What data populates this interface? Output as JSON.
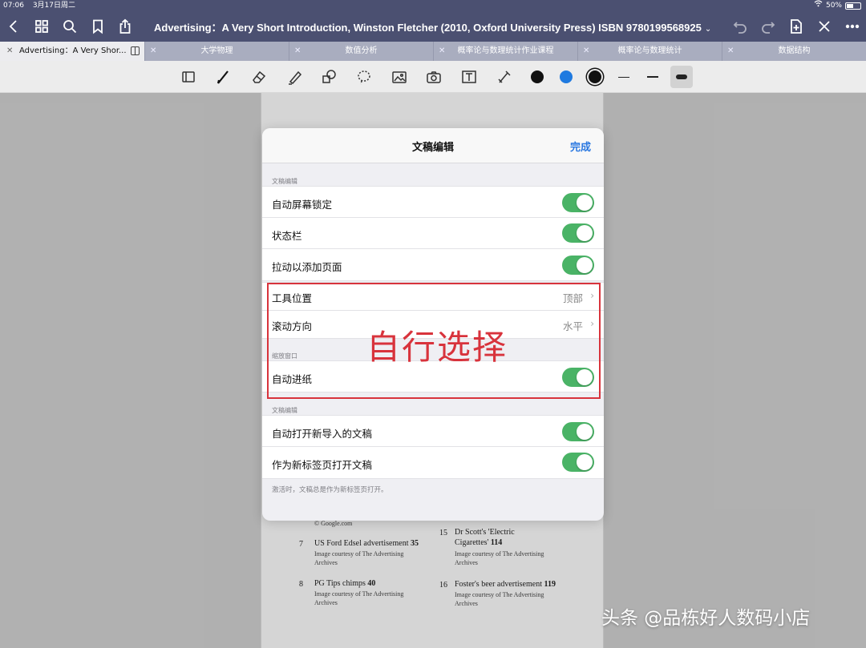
{
  "status_bar": {
    "time": "07:06",
    "date": "3月17日周二",
    "battery": "50%",
    "battery_level": 0.5
  },
  "nav": {
    "doc_title": "Advertising：A Very Short Introduction, Winston Fletcher (2010, Oxford University Press) ISBN 9780199568925",
    "title_chevron": "⌄"
  },
  "tabs": [
    {
      "label": "Advertising：A Very Shor...",
      "active": true
    },
    {
      "label": "大学物理",
      "active": false
    },
    {
      "label": "数值分析",
      "active": false
    },
    {
      "label": "概率论与数理统计作业课程",
      "active": false
    },
    {
      "label": "概率论与数理统计",
      "active": false
    },
    {
      "label": "数据结构",
      "active": false
    }
  ],
  "toolbar": {
    "colors": [
      "#111111",
      "#1f7ae0",
      "#111111"
    ]
  },
  "document": {
    "credit_top": "© Google.com",
    "items": [
      {
        "num": "7",
        "caption": "US Ford Edsel advertisement",
        "page": "35",
        "credit1": "Image courtesy of The Advertising",
        "credit2": "Archives"
      },
      {
        "num": "8",
        "caption": "PG Tips chimps",
        "page": "40",
        "credit1": "Image courtesy of The Advertising",
        "credit2": "Archives"
      },
      {
        "num": "15",
        "caption": "Dr Scott's 'Electric",
        "caption2": "Cigarettes'",
        "page": "114",
        "credit1": "Image courtesy of The Advertising",
        "credit2": "Archives"
      },
      {
        "num": "16",
        "caption": "Foster's beer advertisement",
        "page": "119",
        "credit1": "Image courtesy of The Advertising",
        "credit2": "Archives"
      }
    ]
  },
  "modal": {
    "title": "文稿编辑",
    "done": "完成",
    "section1_label": "文稿编辑",
    "auto_lock": "自动屏幕锁定",
    "status_bar": "状态栏",
    "pull_add_page": "拉动以添加页面",
    "tool_position": "工具位置",
    "tool_position_value": "顶部",
    "scroll_direction": "滚动方向",
    "scroll_direction_value": "水平",
    "section2_label": "缩放窗口",
    "auto_advance": "自动进纸",
    "section3_label": "文稿编辑",
    "auto_open_imported": "自动打开新导入的文稿",
    "open_as_new_tab": "作为新标签页打开文稿",
    "footer_note": "激活时，文稿总是作为新标签页打开。"
  },
  "annotation": {
    "text": "自行选择"
  },
  "watermark": "头条 @品栋好人数码小店"
}
